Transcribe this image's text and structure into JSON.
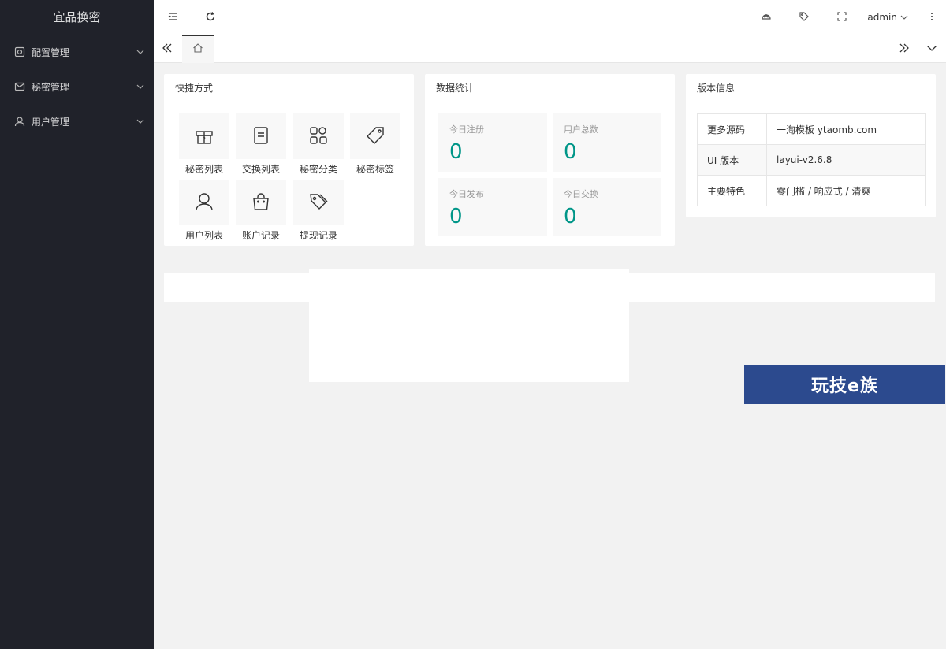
{
  "sidebar": {
    "logo": "宜品换密",
    "items": [
      {
        "label": "配置管理",
        "icon": "settings-icon"
      },
      {
        "label": "秘密管理",
        "icon": "mail-icon"
      },
      {
        "label": "用户管理",
        "icon": "user-icon"
      }
    ]
  },
  "header": {
    "left_icons": [
      "menu-fold-icon",
      "refresh-icon"
    ],
    "right_icons": [
      "theme-icon",
      "tag-icon",
      "fullscreen-icon",
      "more-icon"
    ],
    "user": "admin"
  },
  "tabs": {
    "home_icon": "home-icon"
  },
  "shortcuts": {
    "title": "快捷方式",
    "items": [
      {
        "label": "秘密列表",
        "icon": "gift-box-icon"
      },
      {
        "label": "交换列表",
        "icon": "note-icon"
      },
      {
        "label": "秘密分类",
        "icon": "apps-icon"
      },
      {
        "label": "秘密标签",
        "icon": "tag-icon"
      },
      {
        "label": "用户列表",
        "icon": "user-icon"
      },
      {
        "label": "账户记录",
        "icon": "bag-icon"
      },
      {
        "label": "提现记录",
        "icon": "tags-icon"
      }
    ]
  },
  "stats": {
    "title": "数据统计",
    "items": [
      {
        "label": "今日注册",
        "value": "0"
      },
      {
        "label": "用户总数",
        "value": "0"
      },
      {
        "label": "今日发布",
        "value": "0"
      },
      {
        "label": "今日交换",
        "value": "0"
      }
    ]
  },
  "version": {
    "title": "版本信息",
    "rows": [
      {
        "key": "更多源码",
        "value": "一淘模板 ytaomb.com"
      },
      {
        "key": "UI 版本",
        "value": "layui-v2.6.8"
      },
      {
        "key": "主要特色",
        "value": "零门槛 / 响应式 / 清爽"
      }
    ]
  },
  "watermark": "玩技e族",
  "colors": {
    "sidebar": "#20222a",
    "accent": "#009688",
    "watermark_bg": "#2c4a8e"
  }
}
